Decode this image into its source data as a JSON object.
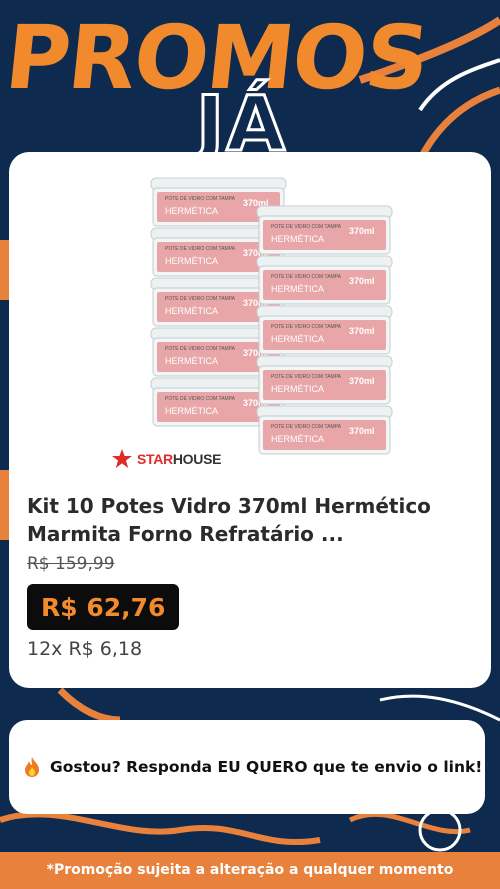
{
  "banner": {
    "headline": "PROMOS",
    "subheadline": "JÁ"
  },
  "product": {
    "brand": "STARHOUSE",
    "title": "Kit 10 Potes Vidro 370ml Hermético Marmita Forno Refratário ...",
    "old_price": "R$ 159,99",
    "price": "R$ 62,76",
    "installments": "12x R$ 6,18",
    "container_label_top": "POTE DE VIDRO",
    "container_label_mid": "COM TAMPA",
    "container_label_main": "HERMÉTICA",
    "container_size": "370ml"
  },
  "cta": {
    "icon": "fire-icon",
    "text": "Gostou? Responda EU QUERO que te envio o link!"
  },
  "footer": {
    "text": "*Promoção sujeita a alteração a qualquer momento"
  },
  "colors": {
    "background": "#0f2a4f",
    "accent": "#f08a2c",
    "price_bg": "#0c0c0c",
    "footer_bg": "#e8813c"
  }
}
